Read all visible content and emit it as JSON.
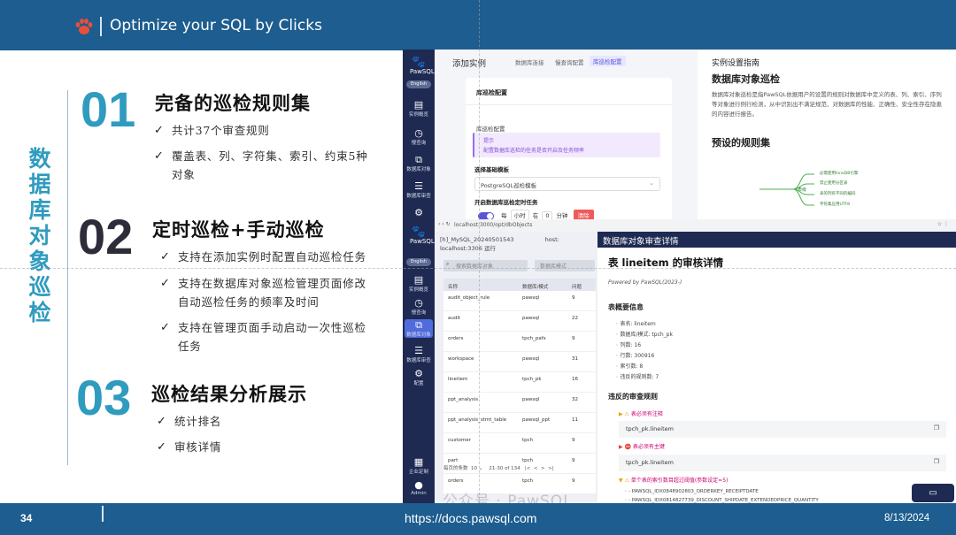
{
  "header": {
    "title": "Optimize your SQL by Clicks"
  },
  "vertical_title": [
    "数",
    "据",
    "库",
    "对",
    "象",
    "巡",
    "检"
  ],
  "sections": [
    {
      "num": "01",
      "title": "完备的巡检规则集",
      "bullets": [
        "共计37个审查规则",
        "覆盖表、列、字符集、索引、约束5种",
        "对象"
      ]
    },
    {
      "num": "02",
      "title": "定时巡检+手动巡检",
      "bullets": [
        "支持在添加实例时配置自动巡检任务",
        "支持在数据库对象巡检管理页面修改",
        "自动巡检任务的频率及时间",
        "支持在管理页面手动启动一次性巡检",
        "任务"
      ]
    },
    {
      "num": "03",
      "title": "巡检结果分析展示",
      "bullets": [
        "统计排名",
        "审核详情"
      ]
    }
  ],
  "footer": {
    "page": "34",
    "url": "https://docs.pawsql.com",
    "date": "8/13/2024"
  },
  "screenshot1": {
    "sidebar": {
      "logo": "PawSQL",
      "lang": "English",
      "items": [
        "实例概览",
        "慢查询",
        "数据库对象",
        "数据库审查"
      ]
    },
    "heading": "添加实例",
    "tabs": [
      "数据库连接",
      "慢查询配置",
      "库巡检配置"
    ],
    "card": {
      "title": "库巡检配置",
      "label": "库巡检配置",
      "tip_title": "提示",
      "tip_body": "配置数据库巡检的任务是否开启及任务频率",
      "template_label": "选择基础模板",
      "template_value": "PostgreSQL巡检模板",
      "schedule_label": "开启数据库巡检定时任务",
      "sched_every": "每",
      "sched_unit": "小时",
      "sched_at": "在",
      "sched_min_value": "0",
      "sched_min_unit": "分钟",
      "clear": "清除"
    },
    "help": {
      "guide": "实例设置指南",
      "title": "数据库对象巡检",
      "para": "数据库对象巡检是指PawSQL依据用户的设置的规则对数据库中定义的表、列、索引、序列等对象进行例行检测，从中识别出不满足规范、对数据库的性能、正确性、安全性存在隐患的内容进行报告。",
      "rules_title": "预设的规则集",
      "tree_root": "表级",
      "tree_leaves": [
        "必需使用InnoDB引擎",
        "禁止使用分区表",
        "表的列有不同的编码",
        "字符集应用UTF8"
      ]
    }
  },
  "screenshot2": {
    "url": "localhost:3000/opt/dbObjects",
    "sidebar": {
      "logo": "PawSQL",
      "lang": "English",
      "items": [
        "实例概览",
        "慢查询",
        "数据库对象",
        "数据库审查",
        "配置",
        "企业定制",
        "Admin"
      ]
    },
    "tab_title": "[h]_MySQL_20240501543",
    "tab_host": "host: localhost:3306 运行",
    "search_placeholder": "搜索数据库对象",
    "filter_placeholder": "数据库模式",
    "table": {
      "headers": [
        "名称",
        "数据库/模式",
        "问题"
      ],
      "rows": [
        [
          "audit_object_rule",
          "pawsql",
          "9"
        ],
        [
          "audit",
          "pawsql",
          "22"
        ],
        [
          "orders",
          "tpch_pafs",
          "9"
        ],
        [
          "workspace",
          "pawsql",
          "31"
        ],
        [
          "lineitem",
          "tpch_pk",
          "16"
        ],
        [
          "ppt_analysis",
          "pawsql",
          "32"
        ],
        [
          "ppt_analysis_stmt_table",
          "pawsql_ppt",
          "11"
        ],
        [
          "customer",
          "tpch",
          "9"
        ],
        [
          "part",
          "tpch",
          "9"
        ],
        [
          "orders",
          "tpch",
          "9"
        ]
      ]
    },
    "pager": {
      "label": "每页的条数",
      "size": "10",
      "range": "21-30 of 134",
      "first": "|<",
      "prev": "<",
      "next": ">",
      "last": ">|"
    },
    "panel": {
      "header": "数据库对象审查详情",
      "title": "表 lineitem 的审核详情",
      "powered": "Powered by PawSQL(2023-)",
      "overview_title": "表概要信息",
      "overview": [
        "表名: lineitem",
        "数据库/模式: tpch_pk",
        "列数: 16",
        "行数: 300916",
        "索引数: 8",
        "违反的规则数: 7"
      ],
      "violations_title": "违反的审查规则",
      "violations": [
        {
          "icon": "warning",
          "label": "表必须有注释",
          "code": "tpch_pk.lineitem"
        },
        {
          "icon": "error",
          "label": "表必须有主键",
          "code": "tpch_pk.lineitem"
        },
        {
          "icon": "warning",
          "label": "单个表的索引数目超过阈值(参数设定=5)"
        }
      ],
      "index_lines": [
        "- PAWSQL_IDX0848902803_ORDERKEY_RECEIPTDATE",
        "- PAWSQL_IDX0814827739_DISCOUNT_SHIPDATE_EXTENDEDPRICE_QUANTITY"
      ]
    }
  },
  "watermark": "公众号 · PawSQL",
  "colors": {
    "brand": "#1d5d8f",
    "accent": "#2f9bbf",
    "sidebar": "#1e2a52"
  }
}
